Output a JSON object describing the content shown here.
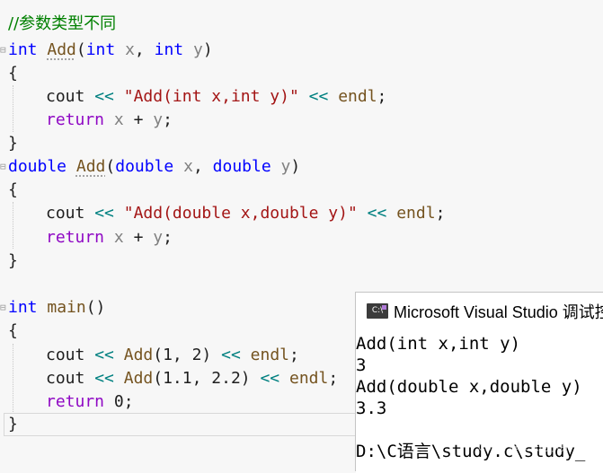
{
  "editor": {
    "comment": "//参数类型不同",
    "add_int": {
      "type": "int",
      "name": "Add",
      "open": "(",
      "p1_type": "int",
      "p1_name": "x",
      "sep": ", ",
      "p2_type": "int",
      "p2_name": "y",
      "close": ")",
      "brace_open": "{",
      "cout": "cout",
      "shift1": "<<",
      "str": "\"Add(int x,int y)\"",
      "shift2": "<<",
      "endl": "endl",
      "semi": ";",
      "ret": "return",
      "rx": "x",
      "plus": "+",
      "ry": "y",
      "semi2": ";",
      "brace_close": "}"
    },
    "add_double": {
      "type": "double",
      "name": "Add",
      "open": "(",
      "p1_type": "double",
      "p1_name": "x",
      "sep": ", ",
      "p2_type": "double",
      "p2_name": "y",
      "close": ")",
      "brace_open": "{",
      "cout": "cout",
      "shift1": "<<",
      "str": "\"Add(double x,double y)\"",
      "shift2": "<<",
      "endl": "endl",
      "semi": ";",
      "ret": "return",
      "rx": "x",
      "plus": "+",
      "ry": "y",
      "semi2": ";",
      "brace_close": "}"
    },
    "main_fn": {
      "type": "int",
      "name": "main",
      "parens": "()",
      "brace_open": "{",
      "l1_cout": "cout",
      "l1_shift": "<<",
      "l1_call": "Add",
      "l1_args": "(1, 2)",
      "l1_shift2": "<<",
      "l1_endl": "endl",
      "l1_semi": ";",
      "l2_cout": "cout",
      "l2_shift": "<<",
      "l2_call": "Add",
      "l2_args": "(1.1, 2.2)",
      "l2_shift2": "<<",
      "l2_endl": "endl",
      "l2_semi": ";",
      "ret": "return",
      "ret_val": "0",
      "ret_semi": ";",
      "brace_close": "}"
    }
  },
  "console": {
    "icon_label": "C:\\",
    "title": "Microsoft Visual Studio 调试控",
    "lines": [
      "Add(int x,int y)",
      "3",
      "Add(double x,double y)",
      "3.3",
      "",
      "D:\\C语言\\study.c\\study_"
    ]
  },
  "watermark": "CSDN @长乐的小贾",
  "colors": {
    "keyword": "#0000ff",
    "string": "#a31515",
    "comment": "#008000",
    "control": "#8f08c4"
  }
}
